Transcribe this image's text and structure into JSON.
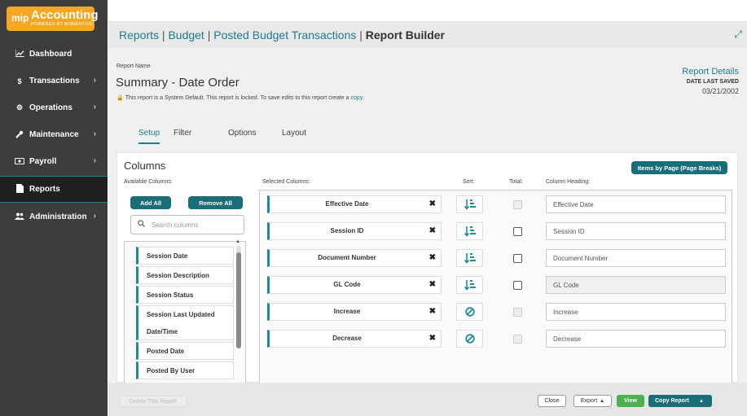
{
  "app": {
    "logo_mark": "mip",
    "name": "Accounting",
    "tagline": "POWERED BY MOMENTIVE",
    "brand_color": "#f5a623",
    "accent_color": "#1a6e78"
  },
  "sidebar": {
    "items": [
      {
        "label": "Dashboard",
        "icon": "chart-line-icon",
        "chevron": false,
        "active": false
      },
      {
        "label": "Transactions",
        "icon": "dollar-icon",
        "chevron": true,
        "active": false
      },
      {
        "label": "Operations",
        "icon": "gears-icon",
        "chevron": true,
        "active": false
      },
      {
        "label": "Maintenance",
        "icon": "wrench-icon",
        "chevron": true,
        "active": false
      },
      {
        "label": "Payroll",
        "icon": "money-bill-icon",
        "chevron": true,
        "active": false
      },
      {
        "label": "Reports",
        "icon": "file-icon",
        "chevron": false,
        "active": true
      },
      {
        "label": "Administration",
        "icon": "users-icon",
        "chevron": true,
        "active": false
      }
    ]
  },
  "breadcrumb": {
    "items": [
      "Reports",
      "Budget",
      "Posted Budget Transactions"
    ],
    "current": "Report Builder",
    "separator": "|"
  },
  "report": {
    "name_label": "Report Name",
    "name": "Summary - Date Order",
    "lock_message": "This report is a System Default. This report is locked. To save edits to this report create a",
    "lock_link": "copy",
    "lock_end": ".",
    "details_title": "Report Details",
    "date_label": "DATE LAST SAVED",
    "date_value": "03/21/2002"
  },
  "tabs": [
    {
      "label": "Setup",
      "active": true
    },
    {
      "label": "Filter",
      "active": false
    },
    {
      "label": "Options",
      "active": false
    },
    {
      "label": "Layout",
      "active": false
    }
  ],
  "columns": {
    "title": "Columns",
    "page_breaks_button": "Items by Page (Page Breaks)",
    "available_label": "Available Columns:",
    "add_all": "Add All",
    "remove_all": "Remove All",
    "search_placeholder": "Search columns",
    "available": [
      {
        "label": "Session Date"
      },
      {
        "label": "Session Description"
      },
      {
        "label": "Session Status"
      },
      {
        "label": "Session Last Updated Date/Time"
      },
      {
        "label": "Posted Date"
      },
      {
        "label": "Posted By User"
      }
    ],
    "selected_label": "Selected Columns:",
    "sort_label": "Sort:",
    "total_label": "Total:",
    "heading_label": "Column Heading:",
    "selected": [
      {
        "name": "Effective Date",
        "sort": "sort-ascending-icon",
        "total_enabled": false,
        "heading": "Effective Date",
        "heading_readonly": false
      },
      {
        "name": "Session ID",
        "sort": "sort-ascending-icon",
        "total_enabled": true,
        "heading": "Session ID",
        "heading_readonly": false
      },
      {
        "name": "Document Number",
        "sort": "sort-ascending-icon",
        "total_enabled": true,
        "heading": "Document Number",
        "heading_readonly": false
      },
      {
        "name": "GL Code",
        "sort": "sort-ascending-icon",
        "total_enabled": true,
        "heading": "GL Code",
        "heading_readonly": true
      },
      {
        "name": "Increase",
        "sort": "no-sort-icon",
        "total_enabled": false,
        "heading": "Increase",
        "heading_readonly": false
      },
      {
        "name": "Decrease",
        "sort": "no-sort-icon",
        "total_enabled": false,
        "heading": "Decrease",
        "heading_readonly": false
      }
    ]
  },
  "footer": {
    "delete": "Delete This Report",
    "close": "Close",
    "export": "Export",
    "view": "View",
    "copy_report": "Copy Report"
  }
}
